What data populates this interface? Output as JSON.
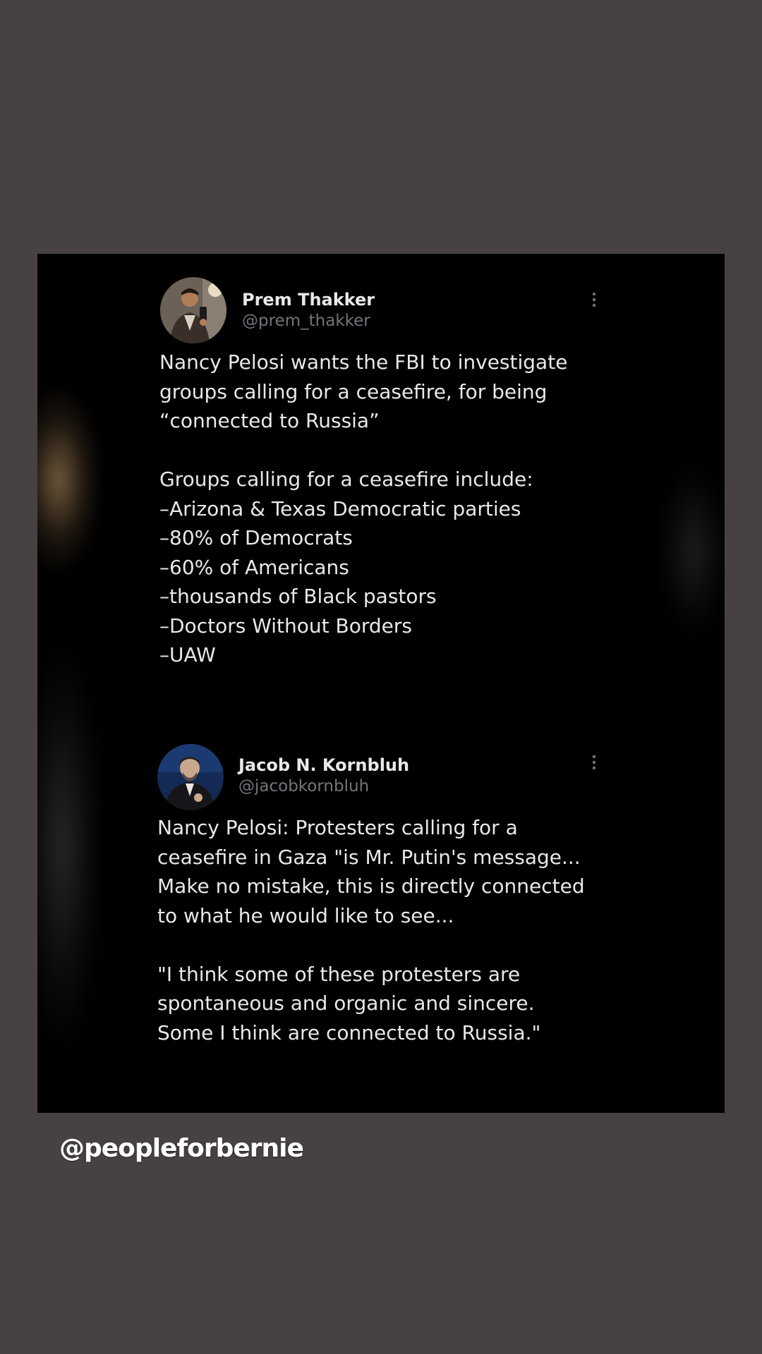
{
  "tweets": [
    {
      "display_name": "Prem Thakker",
      "handle": "@prem_thakker",
      "avatar_icon": "profile-photo",
      "more_icon": "more-options-icon",
      "lines": [
        "Nancy Pelosi wants the FBI to investigate",
        "groups calling for a ceasefire, for being",
        "“connected to Russia”",
        "",
        "Groups calling for a ceasefire include:",
        "–Arizona & Texas Democratic parties",
        "–80% of Democrats",
        "–60% of Americans",
        "–thousands of Black pastors",
        "–Doctors Without Borders",
        "–UAW"
      ]
    },
    {
      "display_name": "Jacob N. Kornbluh",
      "handle": "@jacobkornbluh",
      "avatar_icon": "profile-photo",
      "more_icon": "more-options-icon",
      "lines": [
        "Nancy Pelosi: Protesters calling for a",
        "ceasefire in Gaza \"is Mr. Putin's message...",
        "Make no mistake, this is directly connected",
        "to what he would like to see...",
        "",
        "\"I think some of these protesters are",
        "spontaneous and organic and sincere.",
        "Some I think are connected to Russia.\""
      ]
    }
  ],
  "watermark": "@peopleforbernie",
  "colors": {
    "page_background": "#474142",
    "panel_background": "#000000",
    "text_primary": "#e7e9ea",
    "text_secondary": "#71767b"
  }
}
